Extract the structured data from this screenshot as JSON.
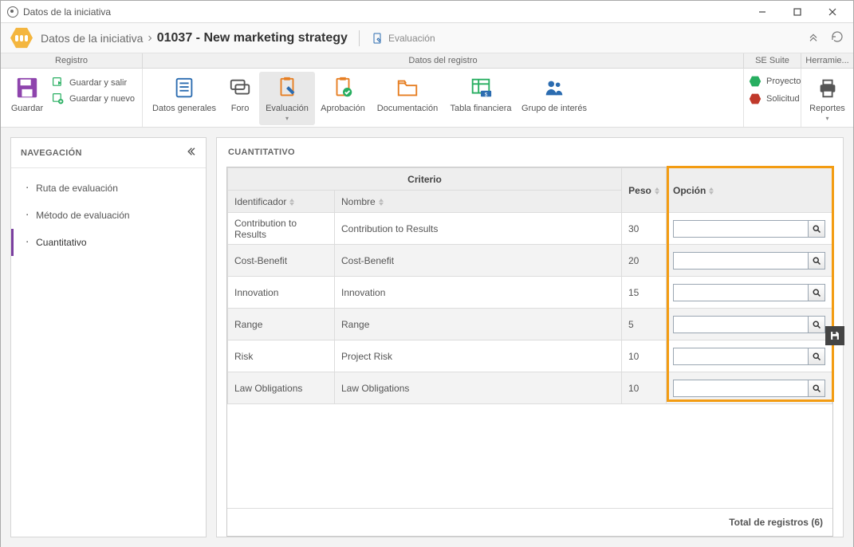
{
  "window": {
    "title": "Datos de la iniciativa"
  },
  "breadcrumb": {
    "root": "Datos de la iniciativa",
    "current": "01037 - New marketing strategy",
    "section": "Evaluación"
  },
  "ribbon_headers": {
    "registro": "Registro",
    "datos": "Datos del registro",
    "suite": "SE Suite",
    "herr": "Herramie..."
  },
  "ribbon": {
    "guardar": "Guardar",
    "guardar_salir": "Guardar y salir",
    "guardar_nuevo": "Guardar y nuevo",
    "datos_generales": "Datos generales",
    "foro": "Foro",
    "evaluacion": "Evaluación",
    "aprobacion": "Aprobación",
    "documentacion": "Documentación",
    "tabla": "Tabla financiera",
    "grupo": "Grupo de interés",
    "proyecto": "Proyecto",
    "solicitud": "Solicitud",
    "reportes": "Reportes"
  },
  "nav": {
    "title": "NAVEGACIÓN",
    "items": [
      {
        "label": "Ruta de evaluación"
      },
      {
        "label": "Método de evaluación"
      },
      {
        "label": "Cuantitativo"
      }
    ]
  },
  "content": {
    "title": "CUANTITATIVO",
    "columns": {
      "criterio_group": "Criterio",
      "identificador": "Identificador",
      "nombre": "Nombre",
      "peso": "Peso",
      "opcion": "Opción"
    },
    "rows": [
      {
        "id": "Contribution to Results",
        "name": "Contribution to Results",
        "peso": "30",
        "op": ""
      },
      {
        "id": "Cost-Benefit",
        "name": "Cost-Benefit",
        "peso": "20",
        "op": ""
      },
      {
        "id": "Innovation",
        "name": "Innovation",
        "peso": "15",
        "op": ""
      },
      {
        "id": "Range",
        "name": "Range",
        "peso": "5",
        "op": ""
      },
      {
        "id": "Risk",
        "name": "Project Risk",
        "peso": "10",
        "op": ""
      },
      {
        "id": "Law Obligations",
        "name": "Law Obligations",
        "peso": "10",
        "op": ""
      }
    ],
    "footer_label": "Total de registros",
    "footer_count": "(6)"
  }
}
